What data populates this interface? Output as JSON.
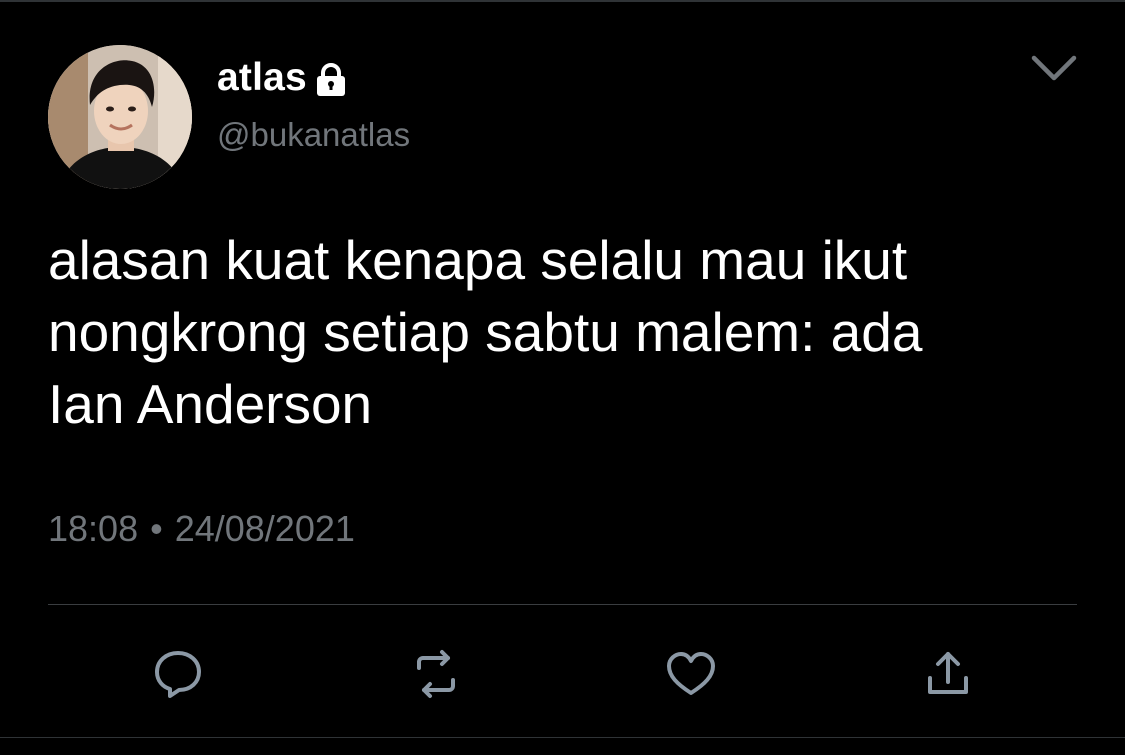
{
  "tweet": {
    "display_name": "atlas",
    "handle": "@bukanatlas",
    "text": "alasan kuat kenapa selalu mau ikut\nnongkrong setiap sabtu malem: ada\nIan Anderson",
    "time": "18:08",
    "separator": "•",
    "date": "24/08/2021",
    "protected_icon": "lock-icon",
    "menu_icon": "chevron-down-icon"
  },
  "actions": [
    {
      "icon": "reply-icon"
    },
    {
      "icon": "retweet-icon"
    },
    {
      "icon": "like-icon"
    },
    {
      "icon": "share-icon"
    }
  ],
  "colors": {
    "background": "#000000",
    "primary_text": "#ffffff",
    "secondary_text": "#71767b",
    "divider": "#3a3d40",
    "icon": "#8b98a5"
  }
}
